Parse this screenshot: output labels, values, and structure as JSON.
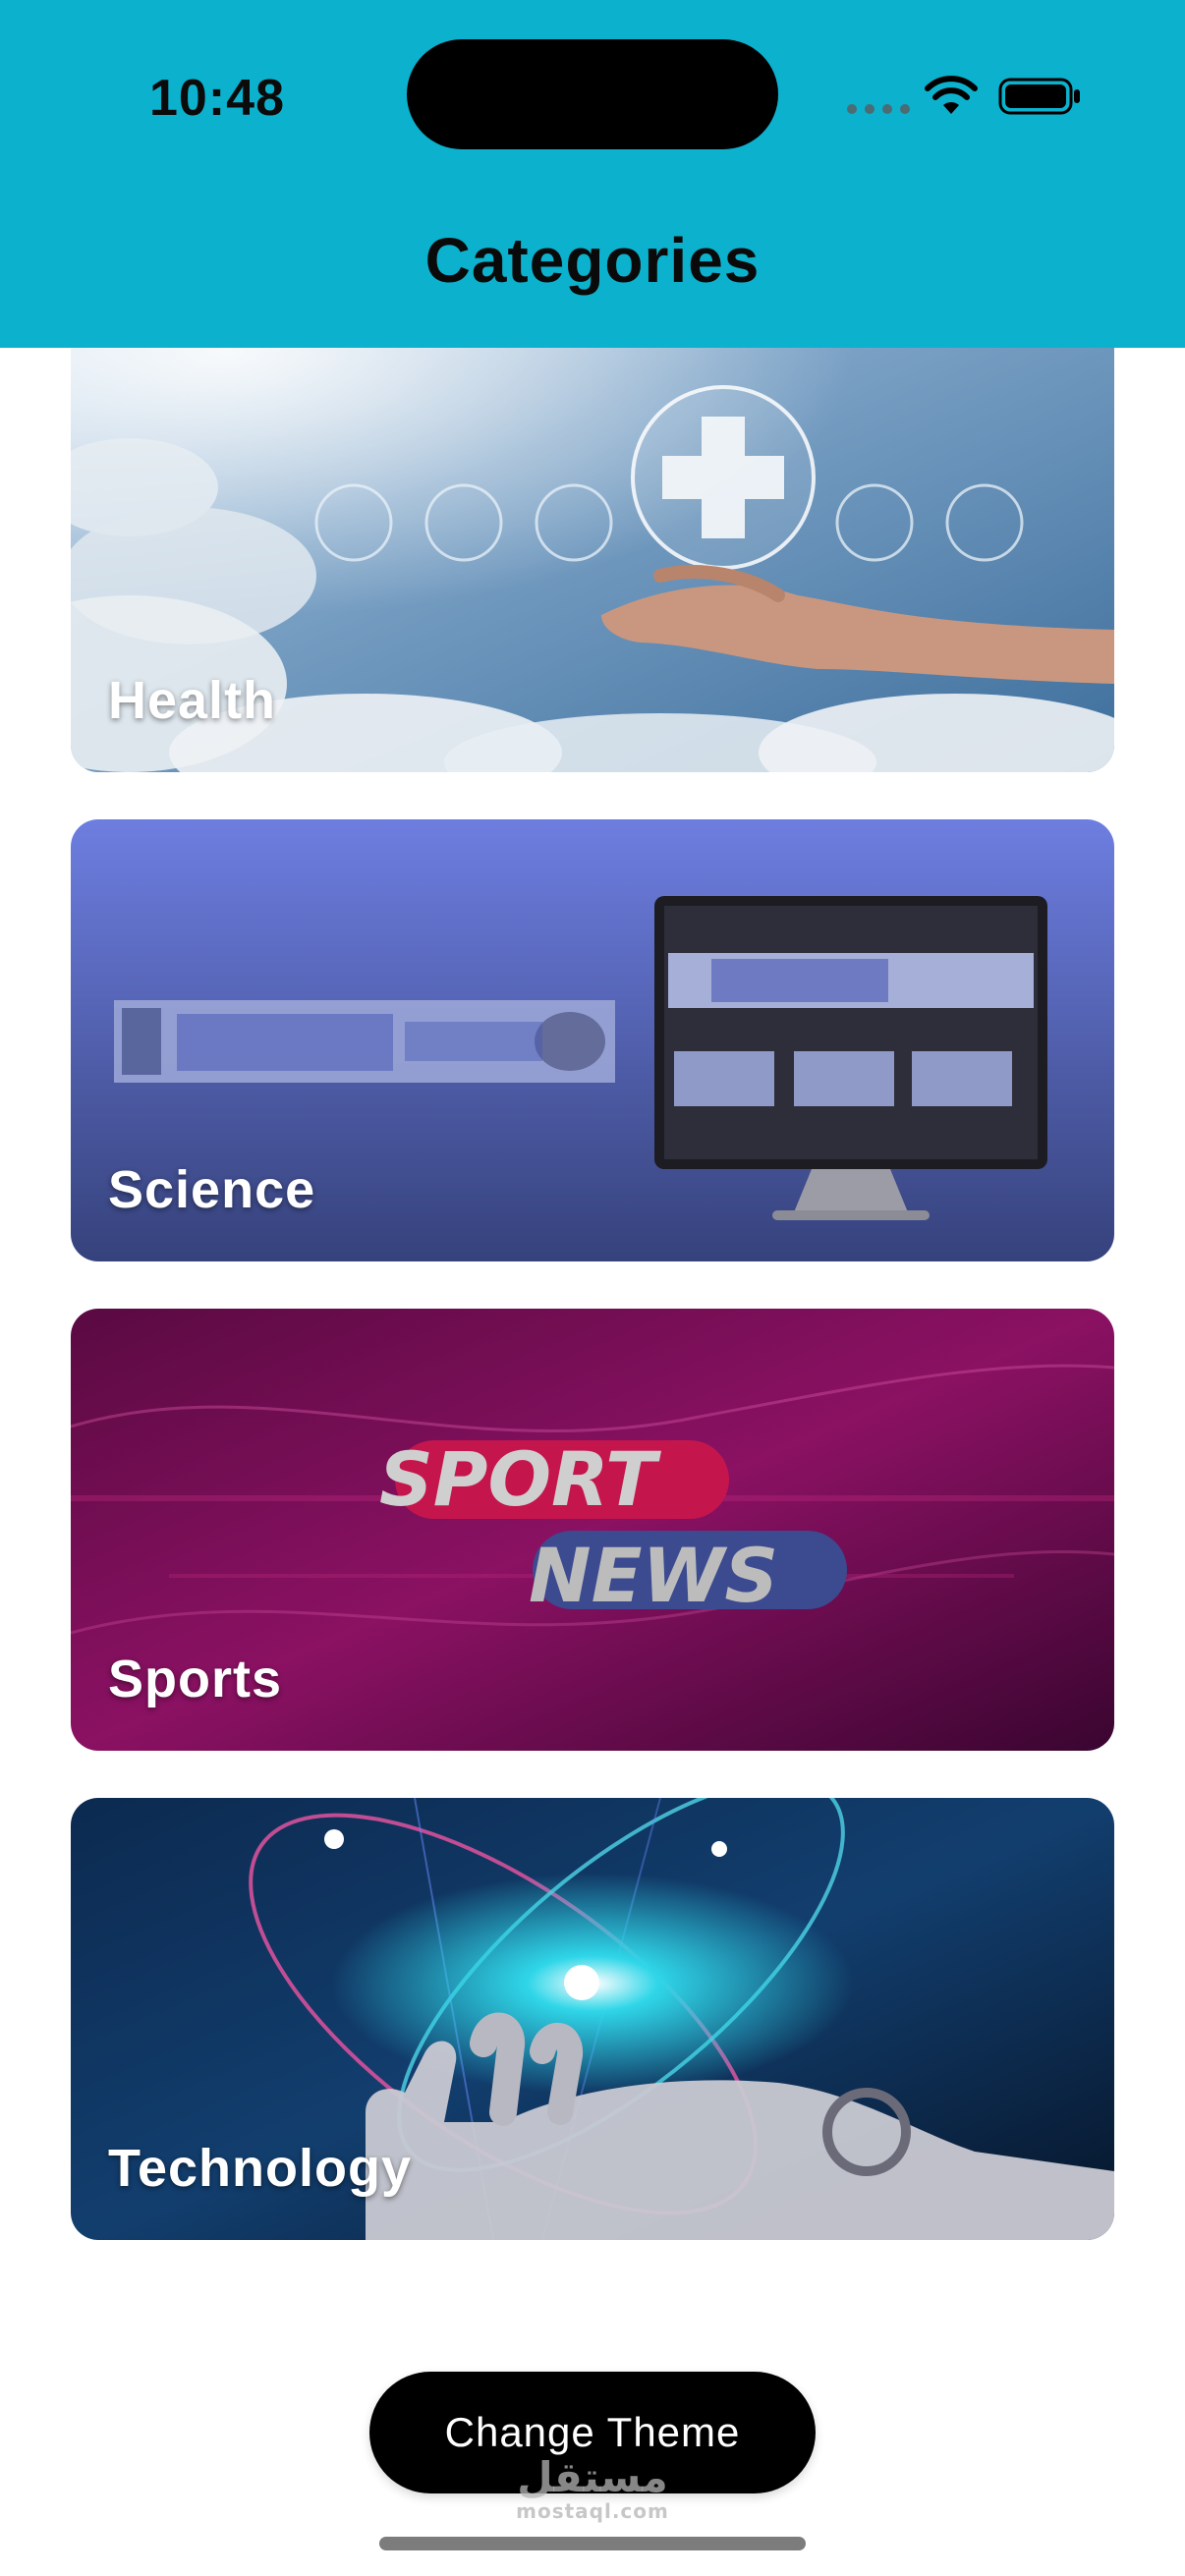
{
  "status_bar": {
    "time": "10:48",
    "icons": [
      "signal-dots-icon",
      "wifi-icon",
      "battery-icon"
    ]
  },
  "header": {
    "title": "Categories",
    "background_color": "#0cb1cd"
  },
  "categories": [
    {
      "label": "Health",
      "image": "hand-medical-icons-sky"
    },
    {
      "label": "Science",
      "image": "science-for-the-future-banner"
    },
    {
      "label": "Sports",
      "image": "sport-news-banner"
    },
    {
      "label": "Technology",
      "image": "robot-hand-atom"
    }
  ],
  "footer": {
    "change_theme_label": "Change Theme",
    "watermark_arabic": "مستقل",
    "watermark_latin": "mostaql.com"
  }
}
